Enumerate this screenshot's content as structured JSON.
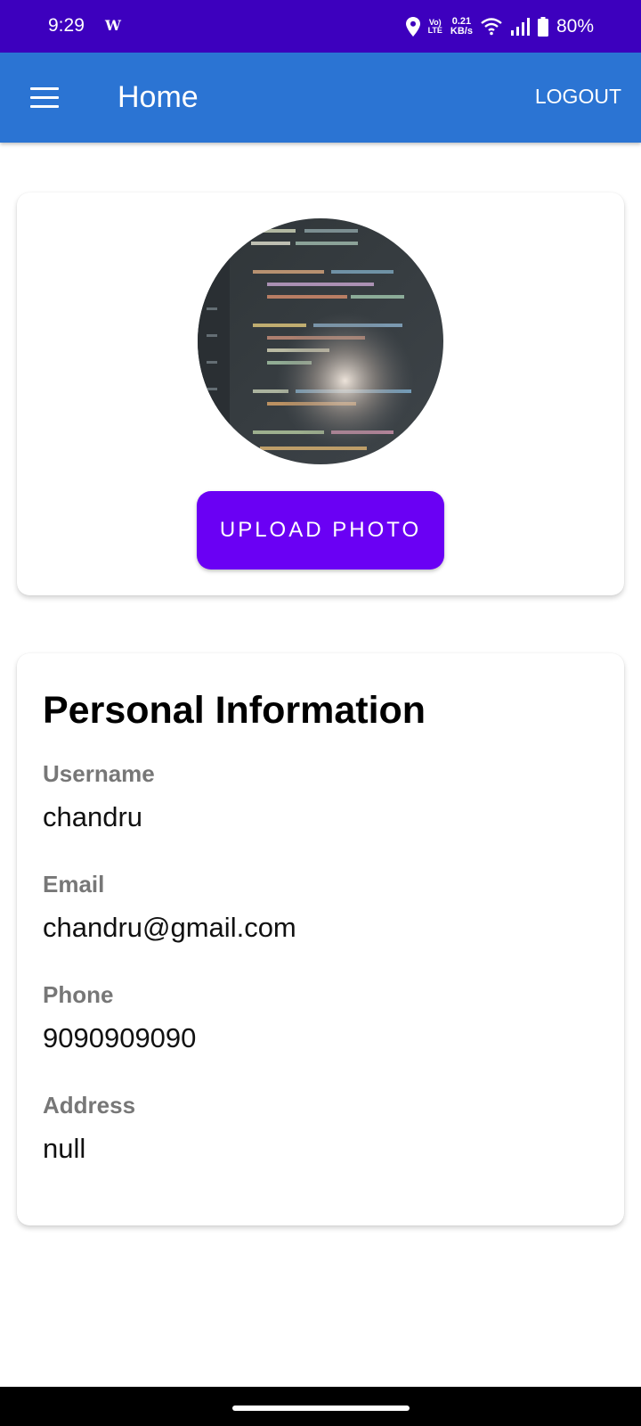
{
  "status_bar": {
    "time": "9:29",
    "carrier_icon_text": "W",
    "volte_line1": "Vo)",
    "volte_line2": "LTE",
    "speed_value": "0.21",
    "speed_unit": "KB/s",
    "battery": "80%"
  },
  "app_bar": {
    "title": "Home",
    "logout_label": "LOGOUT"
  },
  "photo_card": {
    "upload_label": "UPLOAD PHOTO"
  },
  "info_card": {
    "title": "Personal Information",
    "fields": [
      {
        "label": "Username",
        "value": "chandru"
      },
      {
        "label": "Email",
        "value": "chandru@gmail.com"
      },
      {
        "label": "Phone",
        "value": "9090909090"
      },
      {
        "label": "Address",
        "value": "null"
      }
    ]
  },
  "colors": {
    "status_bar": "#3d00be",
    "app_bar": "#2b74d3",
    "upload_button": "#6a00f4"
  },
  "icons": [
    "location-icon",
    "wifi-icon",
    "signal-icon",
    "battery-icon",
    "menu-icon"
  ]
}
